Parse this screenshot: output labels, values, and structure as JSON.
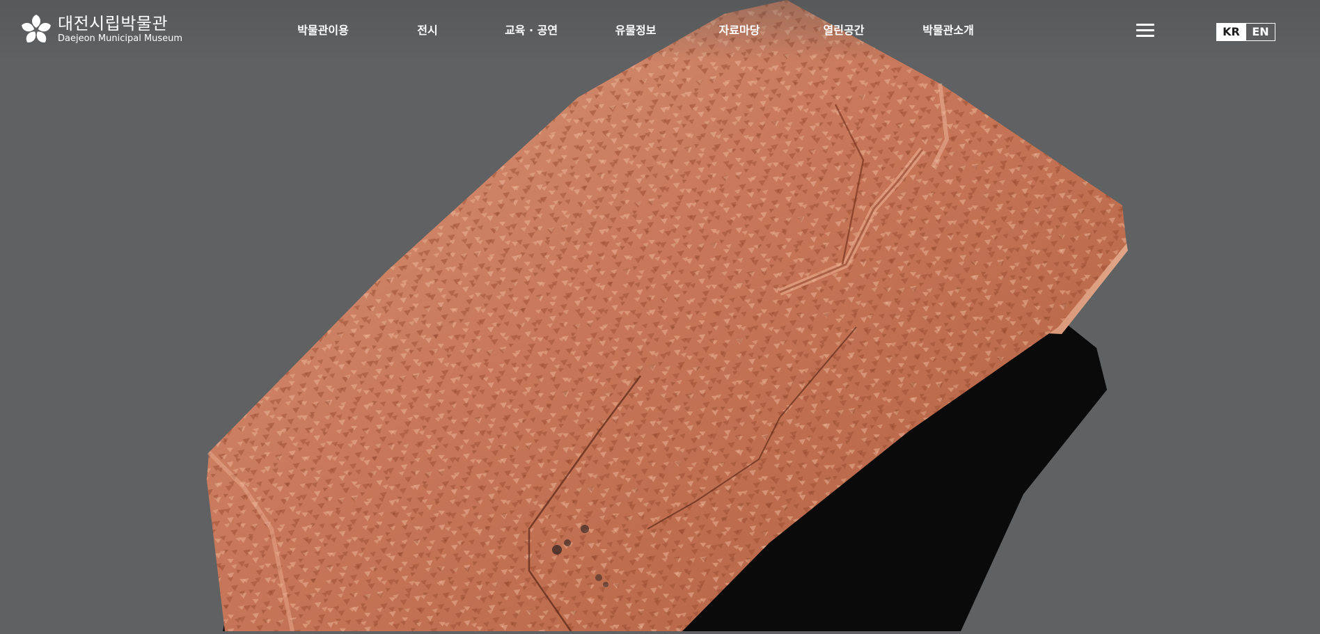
{
  "header": {
    "logo": {
      "name_kr": "대전시립박물관",
      "name_en": "Daejeon Municipal Museum",
      "icon": "star-blossom-emblem"
    },
    "nav": [
      {
        "label": "박물관이용"
      },
      {
        "label": "전시"
      },
      {
        "label": "교육 · 공연"
      },
      {
        "label": "유물정보"
      },
      {
        "label": "자료마당"
      },
      {
        "label": "열린공간"
      },
      {
        "label": "박물관소개"
      }
    ],
    "menu_icon": "hamburger-menu-icon",
    "language": {
      "options": [
        "KR",
        "EN"
      ],
      "selected": "KR"
    }
  },
  "hero": {
    "image": "clay-tablet-photo"
  },
  "colors": {
    "background": "#5f6162",
    "tablet": "#c97a5a",
    "text": "#ffffff"
  }
}
